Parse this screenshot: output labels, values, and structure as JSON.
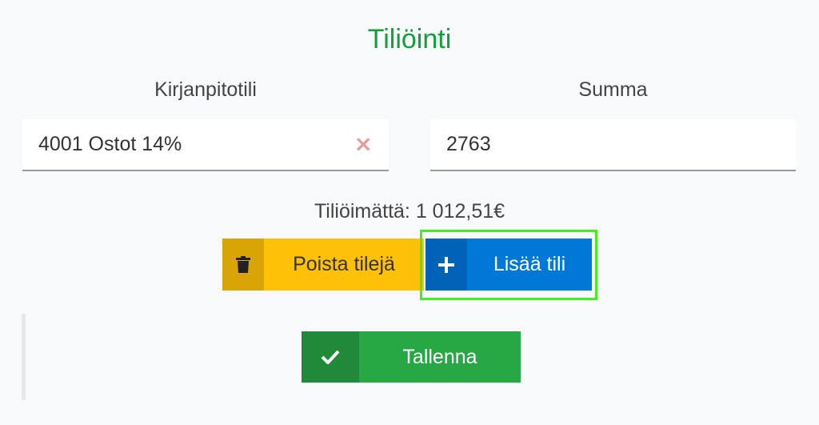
{
  "header": {
    "title": "Tiliöinti"
  },
  "form": {
    "account": {
      "label": "Kirjanpitotili",
      "value": "4001 Ostot 14%",
      "clear_icon": "×"
    },
    "amount": {
      "label": "Summa",
      "value": "2763"
    }
  },
  "status": {
    "unallocated": "Tiliöimättä: 1 012,51€"
  },
  "buttons": {
    "delete_label": "Poista tilejä",
    "add_label": "Lisää tili",
    "save_label": "Tallenna"
  },
  "colors": {
    "title": "#12a03a",
    "delete": "#ffc107",
    "add": "#0078d7",
    "save": "#28a745",
    "focus_ring": "#44ee22"
  },
  "icons": {
    "delete": "trash-icon",
    "add": "plus-icon",
    "save": "check-icon",
    "clear": "close-icon"
  }
}
